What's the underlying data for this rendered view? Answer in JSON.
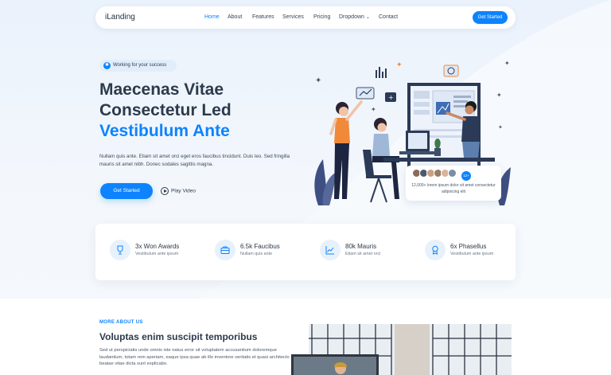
{
  "header": {
    "logo": "iLanding",
    "nav": [
      {
        "label": "Home",
        "active": true
      },
      {
        "label": "About"
      },
      {
        "label": "Features"
      },
      {
        "label": "Services"
      },
      {
        "label": "Pricing"
      },
      {
        "label": "Dropdown",
        "has_chevron": true
      },
      {
        "label": "Contact"
      }
    ],
    "cta_label": "Get Started"
  },
  "hero": {
    "badge": "Working for your success",
    "title_line1": "Maecenas Vitae",
    "title_line2": "Consectetur Led",
    "title_line3": "Vestibulum Ante",
    "lead": "Nullam quis ante. Etiam sit amet orci eget eros faucibus tincidunt. Duis leo. Sed fringilla mauris sit amet nibh. Donec sodales sagittis magna.",
    "cta_label": "Get Started",
    "video_label": "Play Video",
    "review": {
      "count_badge": "12+",
      "text": "12,000+ lorem ipsum dolor sit amet consectetur adipiscing elit"
    }
  },
  "stats": [
    {
      "value": "3x Won Awards",
      "label": "Vestibulum ante ipsum",
      "icon": "trophy-icon"
    },
    {
      "value": "6.5k Faucibus",
      "label": "Nullam quis ante",
      "icon": "briefcase-icon"
    },
    {
      "value": "80k Mauris",
      "label": "Etiam sit amet orci",
      "icon": "graph-up-icon"
    },
    {
      "value": "6x Phasellus",
      "label": "Vestibulum ante ipsum",
      "icon": "award-icon"
    }
  ],
  "about": {
    "kicker": "MORE ABOUT US",
    "title": "Voluptas enim suscipit temporibus",
    "text": "Sed ut perspiciatis unde omnis iste natus error sit voluptatem accusantium doloremque laudantium, totam rem aperiam, eaque ipsa quae ab illo inventore veritatis et quasi architecto beatae vitae dicta sunt explicabo."
  },
  "colors": {
    "accent": "#0d83fd",
    "heading": "#2c3a4b",
    "background": "#eef4fb"
  }
}
